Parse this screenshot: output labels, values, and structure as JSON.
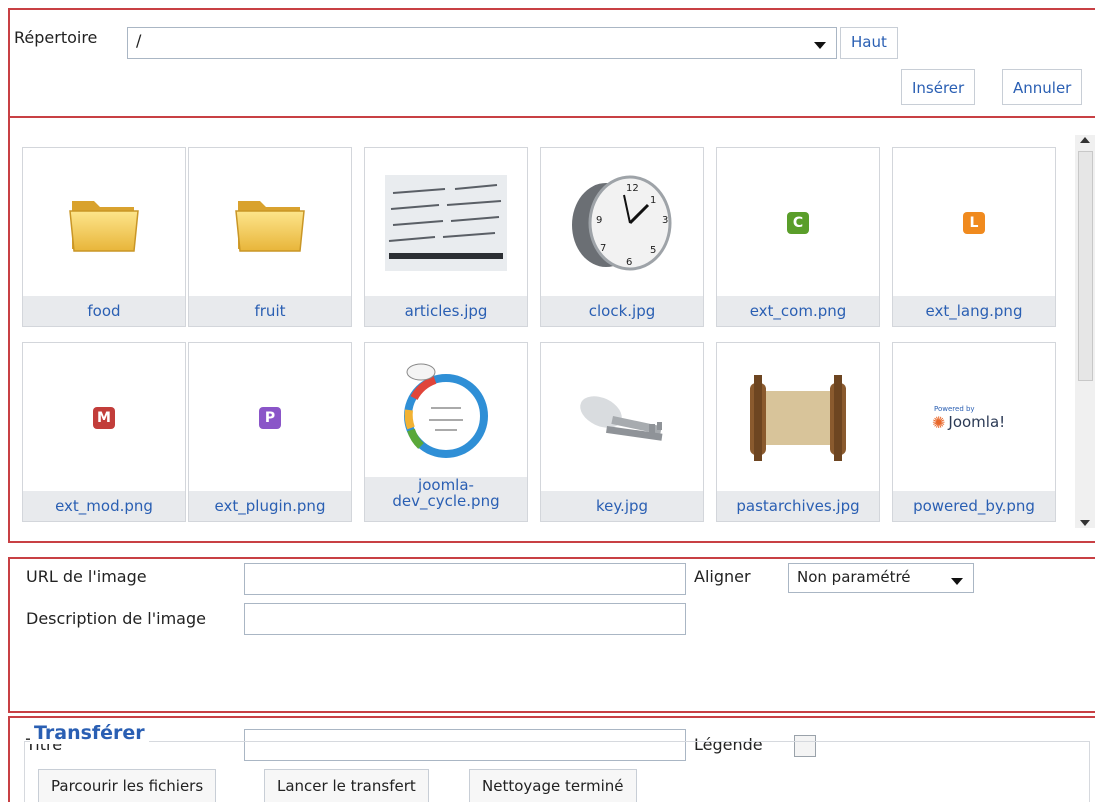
{
  "directory": {
    "label": "Répertoire",
    "value": "/",
    "up_button": "Haut"
  },
  "actions": {
    "insert": "Insérer",
    "cancel": "Annuler"
  },
  "gallery": {
    "items": [
      {
        "name": "food",
        "type": "folder"
      },
      {
        "name": "fruit",
        "type": "folder"
      },
      {
        "name": "articles.jpg",
        "type": "image"
      },
      {
        "name": "clock.jpg",
        "type": "image"
      },
      {
        "name": "ext_com.png",
        "type": "badge",
        "letter": "C",
        "color": "#5a9e2a"
      },
      {
        "name": "ext_lang.png",
        "type": "badge",
        "letter": "L",
        "color": "#f08a1e"
      },
      {
        "name": "ext_mod.png",
        "type": "badge",
        "letter": "M",
        "color": "#c23d3a"
      },
      {
        "name": "ext_plugin.png",
        "type": "badge",
        "letter": "P",
        "color": "#8a55c8"
      },
      {
        "name": "joomla-dev_cycle.png",
        "type": "image",
        "caption_lines": [
          "joomla-",
          "dev_cycle.png"
        ]
      },
      {
        "name": "key.jpg",
        "type": "image"
      },
      {
        "name": "pastarchives.jpg",
        "type": "image"
      },
      {
        "name": "powered_by.png",
        "type": "image",
        "logo_text": "Joomla!",
        "small_text": "Powered by"
      }
    ]
  },
  "form": {
    "url_label": "URL de l'image",
    "url_value": "",
    "description_label": "Description de l'image",
    "description_value": "",
    "title_label": "Titre",
    "title_value": "",
    "align_label": "Aligner",
    "align_value": "Non paramétré",
    "caption_label": "Légende"
  },
  "upload": {
    "legend": "Transférer",
    "browse": "Parcourir les fichiers",
    "start": "Lancer le transfert",
    "clear": "Nettoyage terminé"
  },
  "colors": {
    "link": "#2a5fb3",
    "highlight_border": "#c84044"
  }
}
